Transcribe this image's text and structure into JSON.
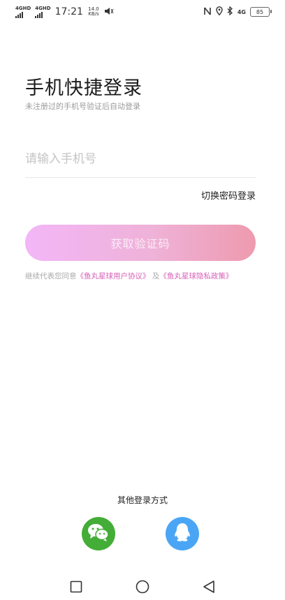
{
  "status_bar": {
    "net1": "4GHD",
    "net2": "4GHD",
    "time": "17:21",
    "speed_value": "14.0",
    "speed_unit": "KB/s",
    "net3": "4G",
    "battery": "85"
  },
  "login": {
    "title": "手机快捷登录",
    "subtitle": "未注册过的手机号验证后自动登录",
    "phone_placeholder": "请输入手机号",
    "switch_password_label": "切换密码登录",
    "get_code_label": "获取验证码",
    "agreement_prefix": "继续代表您同意",
    "user_agreement_link": "《鱼丸星球用户协议》",
    "agreement_and": "及",
    "privacy_link": "《鱼丸星球隐私政策》"
  },
  "other_login": {
    "label": "其他登录方式",
    "options": [
      {
        "name": "wechat",
        "icon": "wechat-icon",
        "color": "#43ad37"
      },
      {
        "name": "qq",
        "icon": "qq-icon",
        "color": "#4aa6f5"
      }
    ]
  },
  "colors": {
    "button_gradient_start": "#f3b6f7",
    "button_gradient_end": "#ee9aae",
    "link": "#d65fb6"
  }
}
